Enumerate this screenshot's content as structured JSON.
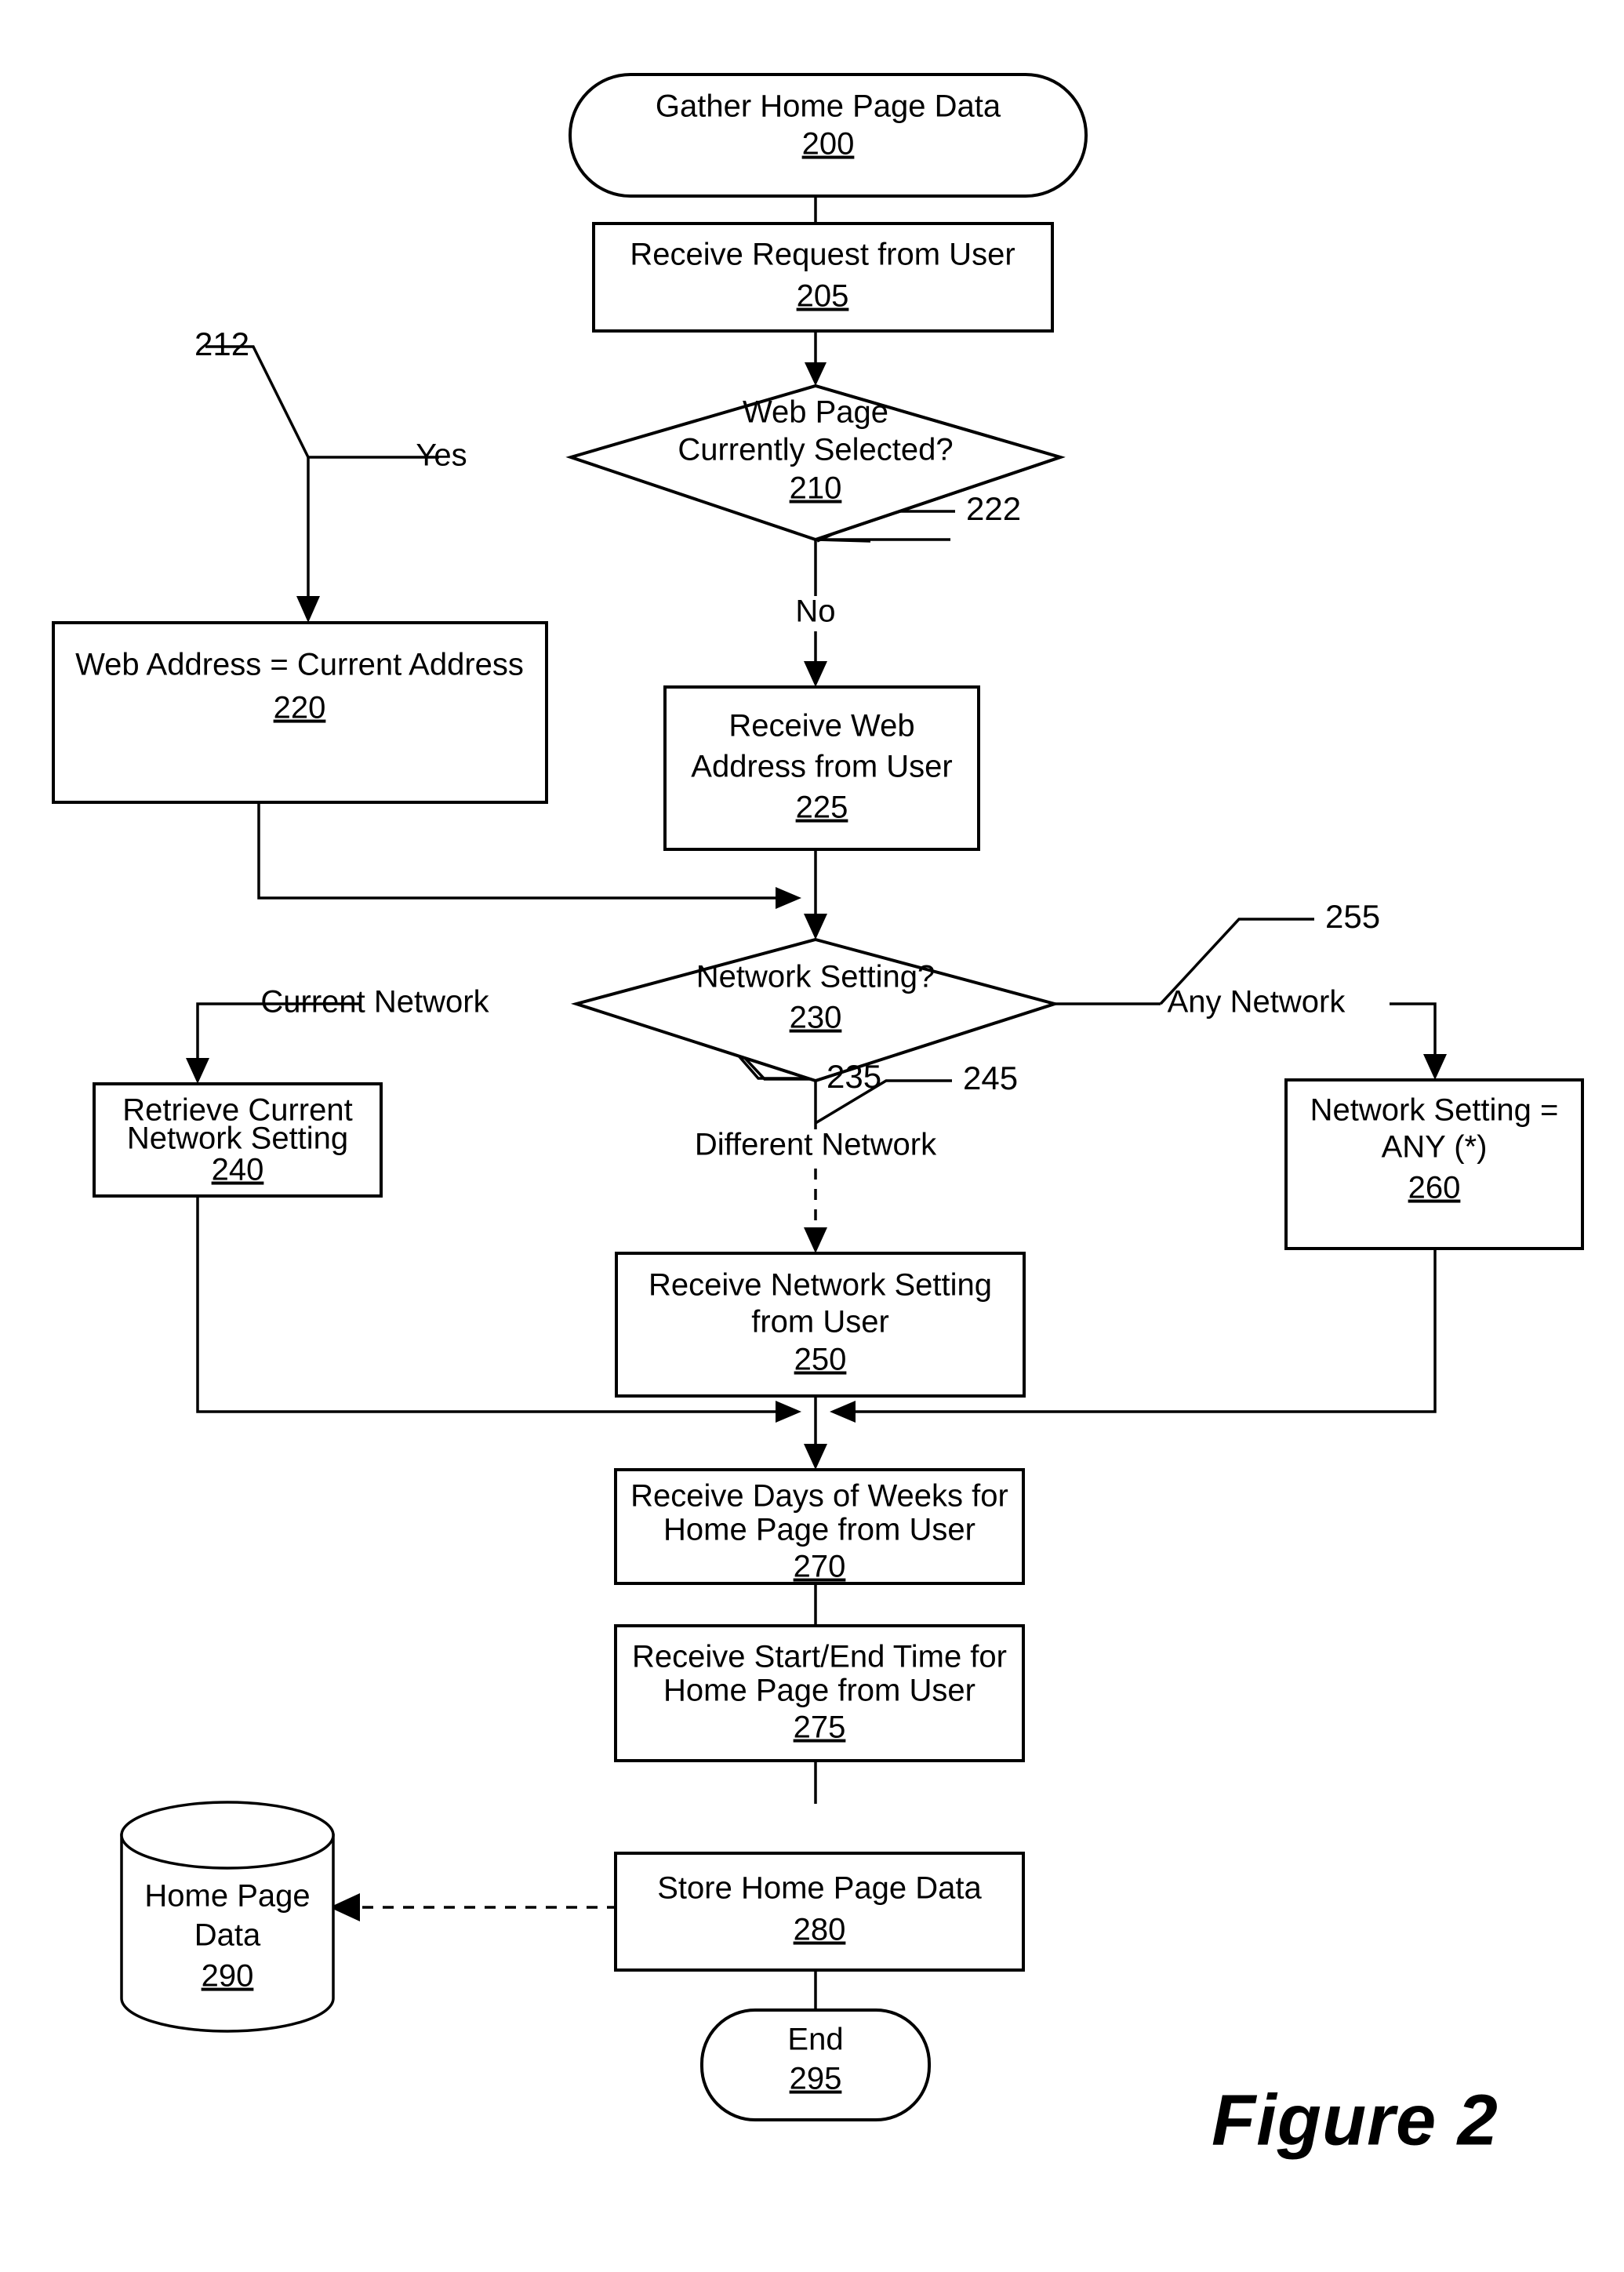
{
  "figure": {
    "caption": "Figure 2",
    "title": "Gather Home Page Data flowchart"
  },
  "nodes": {
    "n200": {
      "type": "terminator",
      "lines": [
        "Gather Home Page Data"
      ],
      "ref": "200"
    },
    "n205": {
      "type": "process",
      "lines": [
        "Receive Request from User"
      ],
      "ref": "205"
    },
    "n210": {
      "type": "decision",
      "lines": [
        "Web Page",
        "Currently Selected?"
      ],
      "ref": "210"
    },
    "n220": {
      "type": "process",
      "lines": [
        "Web Address = Current Address"
      ],
      "ref": "220"
    },
    "n225": {
      "type": "process",
      "lines": [
        "Receive Web",
        "Address from User"
      ],
      "ref": "225"
    },
    "n230": {
      "type": "decision",
      "lines": [
        "Network Setting?"
      ],
      "ref": "230"
    },
    "n240": {
      "type": "process",
      "lines": [
        "Retrieve Current",
        "Network Setting"
      ],
      "ref": "240"
    },
    "n250": {
      "type": "process",
      "lines": [
        "Receive Network Setting",
        "from User"
      ],
      "ref": "250"
    },
    "n260": {
      "type": "process",
      "lines": [
        "Network Setting =",
        "ANY (*)"
      ],
      "ref": "260"
    },
    "n270": {
      "type": "process",
      "lines": [
        "Receive Days of Weeks for",
        "Home Page from User"
      ],
      "ref": "270"
    },
    "n275": {
      "type": "process",
      "lines": [
        "Receive Start/End Time for",
        "Home Page from User"
      ],
      "ref": "275"
    },
    "n280": {
      "type": "process",
      "lines": [
        "Store Home Page Data"
      ],
      "ref": "280"
    },
    "n290": {
      "type": "datastore",
      "lines": [
        "Home Page",
        "Data"
      ],
      "ref": "290"
    },
    "n295": {
      "type": "terminator",
      "lines": [
        "End"
      ],
      "ref": "295"
    }
  },
  "edge_labels": {
    "yes": "Yes",
    "no": "No",
    "current_network": "Current Network",
    "different_network": "Different Network",
    "any_network": "Any Network"
  },
  "reference_numerals": {
    "r212": "212",
    "r222": "222",
    "r235": "235",
    "r245": "245",
    "r255": "255"
  },
  "colors": {
    "stroke": "#000000",
    "fill": "#ffffff",
    "background": "#ffffff"
  }
}
